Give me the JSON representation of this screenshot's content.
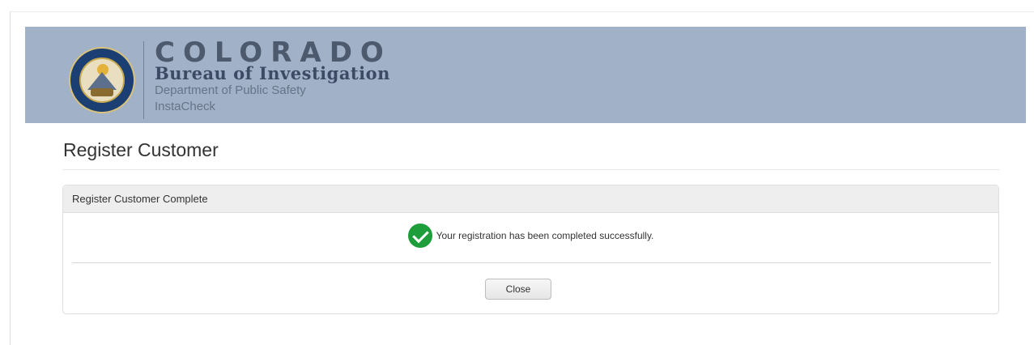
{
  "header": {
    "org_name": "COLORADO",
    "bureau": "Bureau of Investigation",
    "department": "Department of Public Safety",
    "app_name": "InstaCheck",
    "background_color": "#a0b1c8"
  },
  "page": {
    "title": "Register Customer"
  },
  "panel": {
    "header": "Register Customer Complete",
    "status_icon": "check-circle-icon",
    "status_color": "#1e9e3a",
    "message": "Your registration has been completed successfully.",
    "close_label": "Close"
  }
}
